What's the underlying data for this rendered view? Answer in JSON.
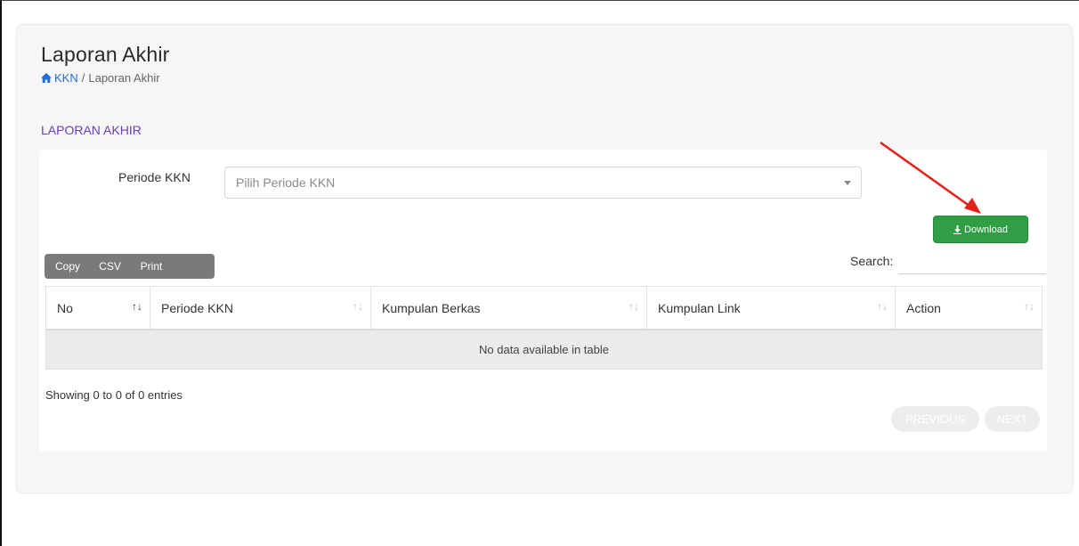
{
  "page": {
    "title": "Laporan Akhir",
    "breadcrumb": {
      "home_label": "KKN",
      "separator": "/",
      "current": "Laporan Akhir"
    },
    "section_title": "LAPORAN AKHIR"
  },
  "filter": {
    "label": "Periode KKN",
    "placeholder": "Pilih Periode KKN"
  },
  "download_button": {
    "label": "Download",
    "icon": "download-icon"
  },
  "export_buttons": [
    "Copy",
    "CSV",
    "Print"
  ],
  "search": {
    "label": "Search:",
    "value": ""
  },
  "table": {
    "columns": [
      "No",
      "Periode KKN",
      "Kumpulan Berkas",
      "Kumpulan Link",
      "Action"
    ],
    "empty_message": "No data available in table"
  },
  "pagination": {
    "info": "Showing 0 to 0 of 0 entries",
    "previous": "PREVIOUS",
    "next": "NEXT"
  },
  "colors": {
    "accent": "#6a3fb8",
    "link": "#1f6fd6",
    "download": "#2f9e44",
    "arrow": "#e32119"
  }
}
